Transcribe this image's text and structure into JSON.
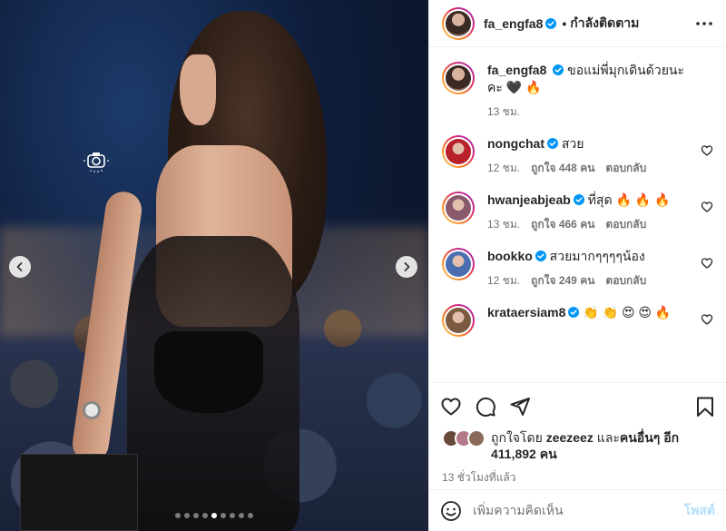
{
  "post": {
    "author": "fa_engfa8",
    "separator": "•",
    "follow_label": "กำลังติดตาม",
    "caption": "ขอแม่พี่มุกเดินด้วยนะคะ",
    "caption_emoji": "🖤 🔥",
    "caption_time": "13 ชม.",
    "slide_count": 9,
    "active_slide": 4
  },
  "comments": [
    {
      "user": "nongchat",
      "text": "สวย",
      "time": "12 ชม.",
      "likes": "ถูกใจ 448 คน",
      "reply": "ตอบกลับ",
      "avatar_color": "#b8202a"
    },
    {
      "user": "hwanjeabjeab",
      "text": "ที่สุด 🔥 🔥 🔥",
      "time": "13 ชม.",
      "likes": "ถูกใจ 466 คน",
      "reply": "ตอบกลับ",
      "avatar_color": "#8a5a6c"
    },
    {
      "user": "bookko",
      "text": "สวยมากๆๆๆๆน้อง",
      "time": "12 ชม.",
      "likes": "ถูกใจ 249 คน",
      "reply": "ตอบกลับ",
      "avatar_color": "#4a6fb0"
    },
    {
      "user": "krataersiam8",
      "text": "👏 👏 😍 😍 🔥",
      "time": "",
      "likes": "",
      "reply": "",
      "avatar_color": "#7a5a40"
    }
  ],
  "likes": {
    "prefix": "ถูกใจโดย",
    "user": "zeezeez",
    "joiner": "และ",
    "others": "คนอื่นๆ อีก",
    "count": "411,892 คน"
  },
  "time_ago": "13 ชั่วโมงที่แล้ว",
  "add_comment": {
    "placeholder": "เพิ่มความคิดเห็น",
    "post_label": "โพสต์"
  },
  "colors": {
    "verified": "#0095f6",
    "post_disabled": "#b2dffc",
    "meta_gray": "#737373"
  }
}
